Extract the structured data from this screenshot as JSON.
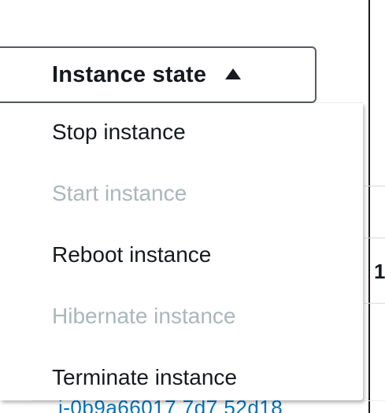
{
  "instance_state_button": {
    "label": "Instance state",
    "icon": "caret-up-icon",
    "expanded": true
  },
  "menu": {
    "items": [
      {
        "label": "Stop instance",
        "enabled": true
      },
      {
        "label": "Start instance",
        "enabled": false
      },
      {
        "label": "Reboot instance",
        "enabled": true
      },
      {
        "label": "Hibernate instance",
        "enabled": false
      },
      {
        "label": "Terminate instance",
        "enabled": true
      }
    ]
  },
  "background": {
    "row_value": "1",
    "instance_id_fragment": "i-0b9a66017 7d7 52d18"
  },
  "colors": {
    "text": "#16191f",
    "disabled_text": "#aab7b8",
    "link": "#0073bb",
    "button_border": "#545b64"
  }
}
